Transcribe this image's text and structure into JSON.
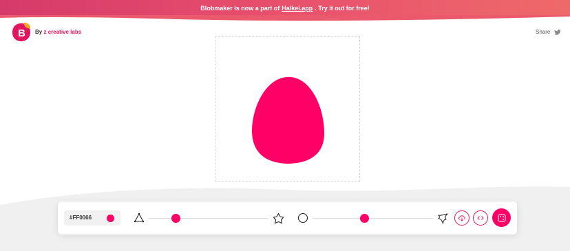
{
  "banner": {
    "text_before": "Blobmaker is now a part of",
    "link_text": "Haikei.app",
    "text_after": ". Try it out for free!"
  },
  "header": {
    "logo_letter": "B",
    "by_label": "By",
    "brand": "z creative labs",
    "share_label": "Share"
  },
  "controls": {
    "color_hex": "#FF0066",
    "complexity_level": 0.25,
    "contrast_level": 0.45
  },
  "icons": {
    "logo": "blobmaker-logo",
    "twitter": "twitter-icon",
    "complexity_low": "triangle-icon",
    "complexity_high": "star-polygon-icon",
    "contrast_low": "circle-icon",
    "contrast_high": "spiky-blob-icon",
    "download": "download-icon",
    "code": "code-icon",
    "random": "dice-icon"
  },
  "colors": {
    "accent": "#FF0066",
    "brand_pink": "#e3155f",
    "logo_orange": "#f5a623"
  }
}
